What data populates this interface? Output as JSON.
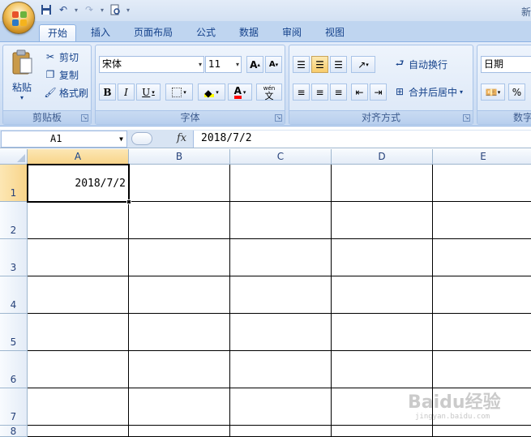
{
  "window": {
    "title": "新"
  },
  "qat": {
    "more_label": "▾"
  },
  "tabs": [
    "开始",
    "插入",
    "页面布局",
    "公式",
    "数据",
    "审阅",
    "视图"
  ],
  "clipboard": {
    "paste": "粘贴",
    "cut": "剪切",
    "copy": "复制",
    "format_painter": "格式刷",
    "label": "剪贴板"
  },
  "font": {
    "name": "宋体",
    "size": "11",
    "bold": "B",
    "italic": "I",
    "underline": "U",
    "font_color": "A",
    "phonetic": "wén",
    "phonetic_char": "文",
    "grow": "A",
    "shrink": "A",
    "label": "字体"
  },
  "alignment": {
    "wrap_text": "自动换行",
    "merge_center": "合并后居中",
    "label": "对齐方式"
  },
  "number": {
    "format": "日期",
    "percent": "%",
    "label": "数字"
  },
  "formula_bar": {
    "name_box": "A1",
    "fx": "fx",
    "content": "2018/7/2"
  },
  "grid": {
    "columns": [
      "A",
      "B",
      "C",
      "D",
      "E"
    ],
    "rows": [
      "1",
      "2",
      "3",
      "4",
      "5",
      "6",
      "7",
      "8"
    ],
    "cells": {
      "A1": "2018/7/2"
    }
  },
  "watermark": {
    "text": "Baidu经验",
    "sub": "jingyan.baidu.com"
  }
}
